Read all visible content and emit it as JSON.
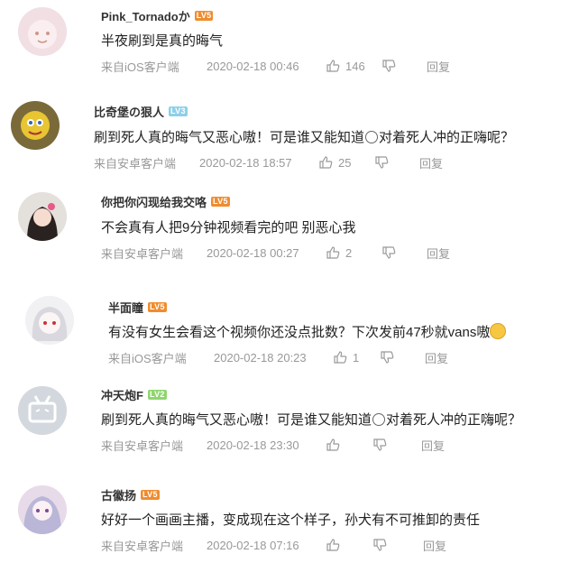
{
  "comments": [
    {
      "username": "Pink_Tornadoか",
      "level": "LV5",
      "level_color": "#f08c2e",
      "text": "半夜刷到是真的晦气",
      "source": "来自iOS客户端",
      "time": "2020-02-18 00:46",
      "likes": "146",
      "reply_label": "回复"
    },
    {
      "username": "比奇堡の狠人",
      "level": "LV3",
      "level_color": "#8ed0e8",
      "text_before": "刷到死人真的晦气又恶心嗷！可是谁又能知道",
      "text_after": "对着死人冲的正嗨呢？",
      "source": "来自安卓客户端",
      "time": "2020-02-18 18:57",
      "likes": "25",
      "reply_label": "回复"
    },
    {
      "username": "你把你闪现给我交咯",
      "level": "LV5",
      "level_color": "#f08c2e",
      "text": "不会真有人把9分钟视频看完的吧 别恶心我",
      "source": "来自安卓客户端",
      "time": "2020-02-18 00:27",
      "likes": "2",
      "reply_label": "回复"
    },
    {
      "username": "半面瞳",
      "level": "LV5",
      "level_color": "#f08c2e",
      "text": "有没有女生会看这个视频你还没点批数？下次发前47秒就vans嗷",
      "source": "来自iOS客户端",
      "time": "2020-02-18 20:23",
      "likes": "1",
      "reply_label": "回复"
    },
    {
      "username": "冲天炮F",
      "level": "LV2",
      "level_color": "#8fd66e",
      "text_before": "刷到死人真的晦气又恶心嗷！可是谁又能知道",
      "text_after": "对着死人冲的正嗨呢？",
      "source": "来自安卓客户端",
      "time": "2020-02-18 23:30",
      "reply_label": "回复"
    },
    {
      "username": "古徽扬",
      "level": "LV5",
      "level_color": "#f08c2e",
      "text": "好好一个画画主播，变成现在这个样子，孙犬有不可推卸的责任",
      "source": "来自安卓客户端",
      "time": "2020-02-18 07:16",
      "reply_label": "回复"
    }
  ]
}
